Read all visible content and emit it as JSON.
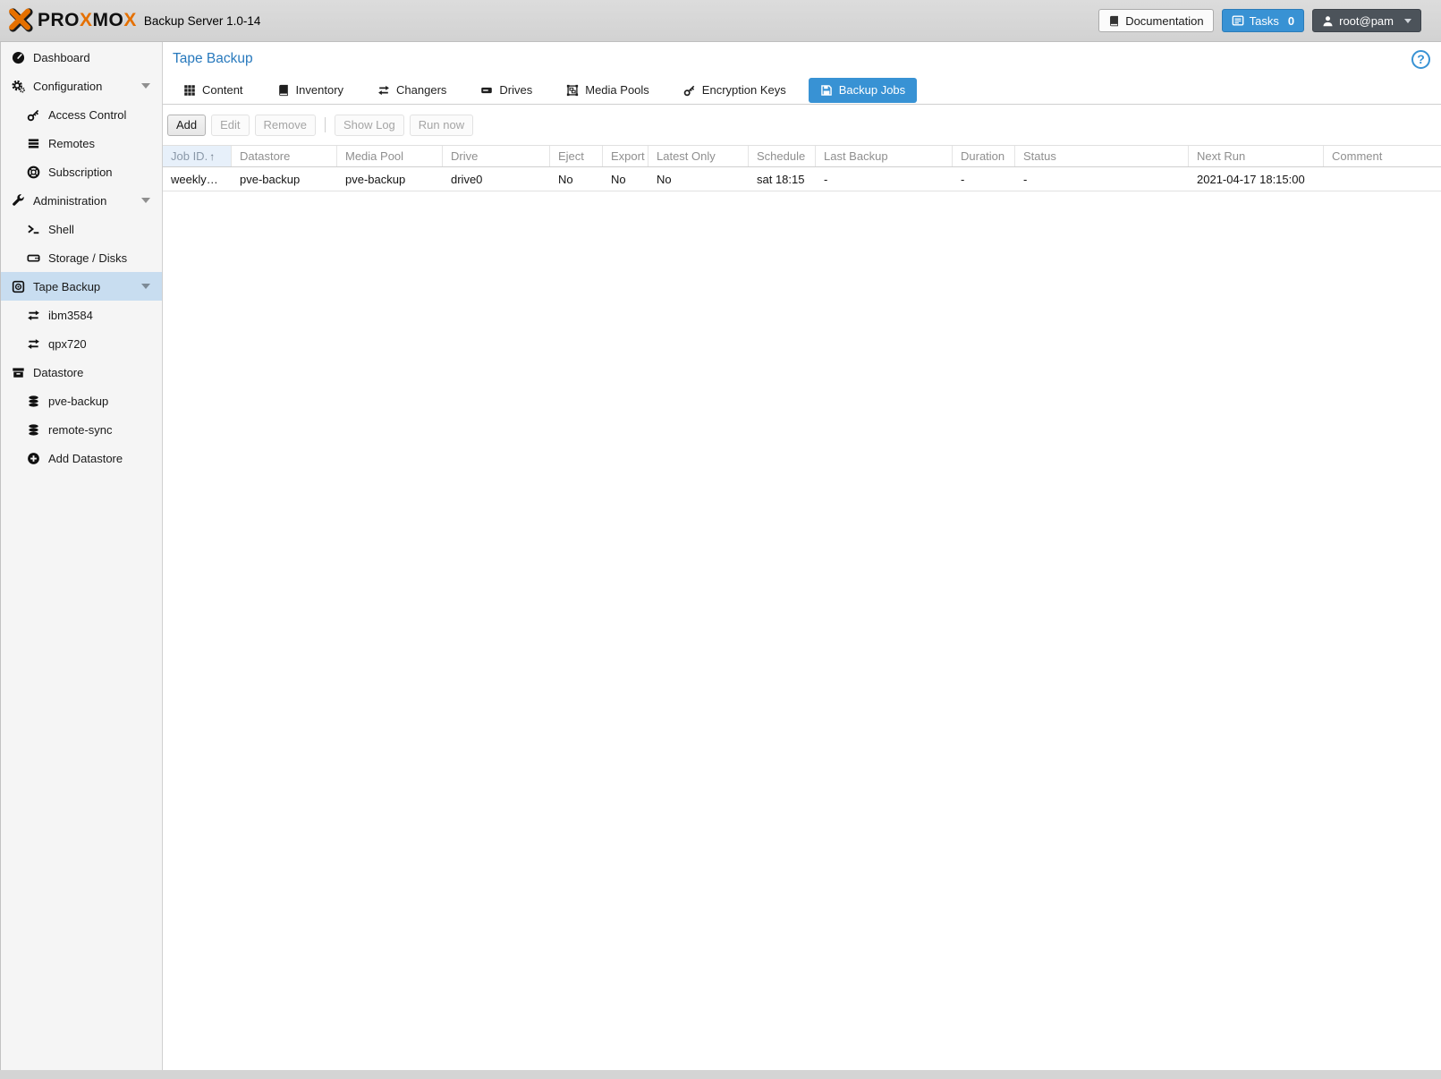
{
  "header": {
    "logo_pro": "PRO",
    "logo_x1": "X",
    "logo_mo": "MO",
    "logo_x2": "X",
    "product": "Backup Server 1.0-14",
    "documentation_label": "Documentation",
    "tasks_label": "Tasks",
    "tasks_count": "0",
    "user_label": "root@pam"
  },
  "colors": {
    "accent": "#3892d4",
    "logo_orange": "#e57000",
    "selected_item_bg": "#c8ddf0"
  },
  "sidebar": {
    "items": [
      {
        "label": "Dashboard",
        "icon": "gauge-icon"
      },
      {
        "label": "Configuration",
        "icon": "gears-icon"
      },
      {
        "label": "Access Control",
        "icon": "key-icon"
      },
      {
        "label": "Remotes",
        "icon": "server-list-icon"
      },
      {
        "label": "Subscription",
        "icon": "life-ring-icon"
      },
      {
        "label": "Administration",
        "icon": "wrench-icon"
      },
      {
        "label": "Shell",
        "icon": "terminal-icon"
      },
      {
        "label": "Storage / Disks",
        "icon": "hdd-icon"
      },
      {
        "label": "Tape Backup",
        "icon": "tape-icon",
        "selected": true
      },
      {
        "label": "ibm3584",
        "icon": "exchange-icon"
      },
      {
        "label": "qpx720",
        "icon": "exchange-icon"
      },
      {
        "label": "Datastore",
        "icon": "archive-box-icon"
      },
      {
        "label": "pve-backup",
        "icon": "database-icon"
      },
      {
        "label": "remote-sync",
        "icon": "database-icon"
      },
      {
        "label": "Add Datastore",
        "icon": "plus-circle-icon"
      }
    ]
  },
  "main": {
    "title": "Tape Backup",
    "tabs": [
      {
        "label": "Content",
        "icon": "grid-icon",
        "active": false
      },
      {
        "label": "Inventory",
        "icon": "book-icon",
        "active": false
      },
      {
        "label": "Changers",
        "icon": "exchange-icon",
        "active": false
      },
      {
        "label": "Drives",
        "icon": "drive-icon",
        "active": false
      },
      {
        "label": "Media Pools",
        "icon": "object-group-icon",
        "active": false
      },
      {
        "label": "Encryption Keys",
        "icon": "key-icon",
        "active": false
      },
      {
        "label": "Backup Jobs",
        "icon": "save-icon",
        "active": true
      }
    ],
    "toolbar": {
      "add_label": "Add",
      "edit_label": "Edit",
      "remove_label": "Remove",
      "show_log_label": "Show Log",
      "run_now_label": "Run now"
    },
    "table": {
      "sort_icon": "↑",
      "columns": [
        {
          "label": "Job ID.",
          "sorted": "asc"
        },
        {
          "label": "Datastore"
        },
        {
          "label": "Media Pool"
        },
        {
          "label": "Drive"
        },
        {
          "label": "Eject"
        },
        {
          "label": "Export"
        },
        {
          "label": "Latest Only"
        },
        {
          "label": "Schedule"
        },
        {
          "label": "Last Backup"
        },
        {
          "label": "Duration"
        },
        {
          "label": "Status"
        },
        {
          "label": "Next Run"
        },
        {
          "label": "Comment"
        }
      ],
      "rows": [
        [
          "weekly…",
          "pve-backup",
          "pve-backup",
          "drive0",
          "No",
          "No",
          "No",
          "sat 18:15",
          "-",
          "-",
          "-",
          "2021-04-17 18:15:00",
          ""
        ]
      ]
    }
  }
}
